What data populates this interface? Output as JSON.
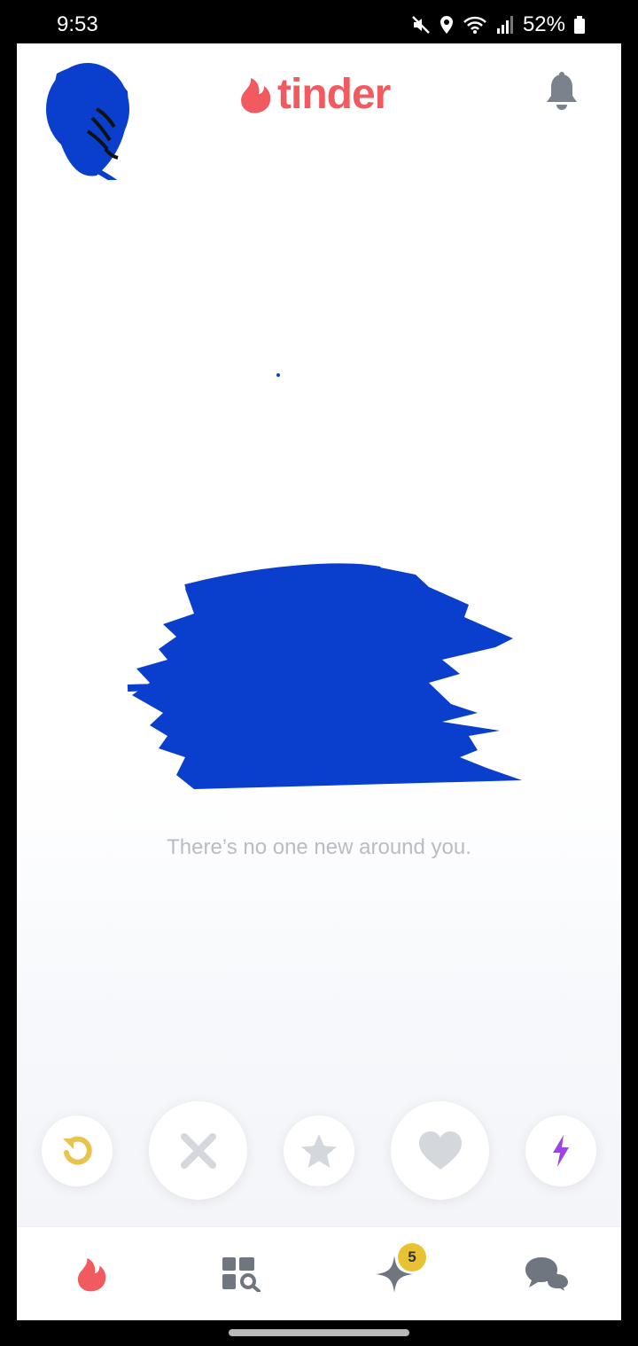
{
  "status_bar": {
    "time": "9:53",
    "battery": "52%",
    "icons": [
      "mute-icon",
      "location-icon",
      "wifi-icon",
      "signal-icon",
      "battery-icon"
    ]
  },
  "header": {
    "brand": "tinder",
    "brand_color": "#f15a5e",
    "left_icon": "profile-avatar",
    "right_icon": "bell-icon"
  },
  "main": {
    "empty_message": "There’s no one new around you."
  },
  "actions": [
    {
      "name": "rewind",
      "icon": "rewind-icon",
      "color": "#e8c44f"
    },
    {
      "name": "nope",
      "icon": "x-icon",
      "color": "#d4d7dc"
    },
    {
      "name": "super-like",
      "icon": "star-icon",
      "color": "#d4d7dc"
    },
    {
      "name": "like",
      "icon": "heart-icon",
      "color": "#d4d7dc"
    },
    {
      "name": "boost",
      "icon": "bolt-icon",
      "color": "#9b45e8"
    }
  ],
  "bottom_nav": {
    "items": [
      {
        "name": "home",
        "icon": "flame-icon",
        "color": "#f15a5e"
      },
      {
        "name": "explore",
        "icon": "explore-icon",
        "color": "#6f7680"
      },
      {
        "name": "gold",
        "icon": "sparkle-icon",
        "color": "#6f7680"
      },
      {
        "name": "messages",
        "icon": "chat-icon",
        "color": "#6f7680"
      }
    ],
    "gold_badge": "5",
    "badge_color": "#e9c233"
  },
  "redaction_color": "#0a3fce"
}
